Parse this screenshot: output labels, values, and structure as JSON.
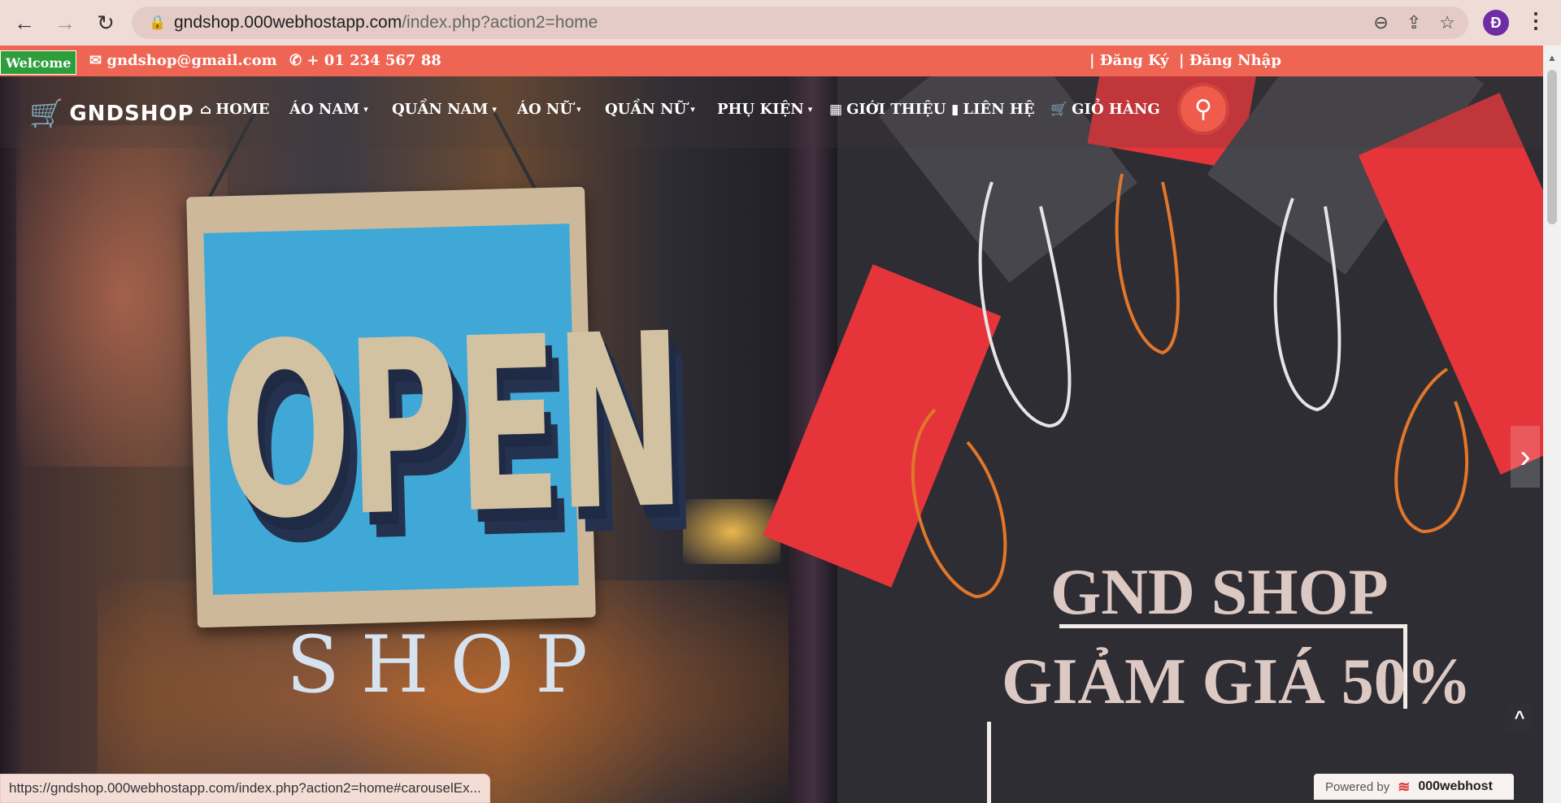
{
  "browser": {
    "url_host": "gndshop.000webhostapp.com",
    "url_path": "/index.php?action2=home",
    "profile_initial": "Đ",
    "status_url": "https://gndshop.000webhostapp.com/index.php?action2=home#carouselEx..."
  },
  "topbar": {
    "welcome": "Welcome",
    "email": "gndshop@gmail.com",
    "phone": "+ 01 234 567 88",
    "register": "| Đăng Ký",
    "login": "| Đăng Nhập"
  },
  "navbar": {
    "logo_text": "GNDSHOP",
    "items": [
      {
        "label": "HOME",
        "icon": "home-icon"
      },
      {
        "label": "ÁO NAM",
        "icon": "chevron-down-icon"
      },
      {
        "label": "QUẦN NAM",
        "icon": "chevron-down-icon"
      },
      {
        "label": "ÁO NỮ",
        "icon": "chevron-down-icon"
      },
      {
        "label": "QUẦN NỮ",
        "icon": "chevron-down-icon"
      },
      {
        "label": "PHỤ KIỆN",
        "icon": "chevron-down-icon"
      },
      {
        "label": "GIỚI THIỆU",
        "icon": "calendar-icon"
      },
      {
        "label": "LIÊN HỆ",
        "icon": "contact-card-icon"
      },
      {
        "label": "GIỎ HÀNG",
        "icon": "cart-icon"
      }
    ]
  },
  "hero": {
    "sign_word": "OPEN",
    "shop_word": "SHOP",
    "promo_line1": "GND SHOP",
    "promo_line2": "GIẢM GIÁ 50%"
  },
  "footer": {
    "powered_by": "Powered by",
    "powered_brand": "000webhost"
  },
  "colors": {
    "topbar": "#ef6553",
    "welcome_badge": "#2e9e3b",
    "search_button": "#ef5c4c"
  }
}
